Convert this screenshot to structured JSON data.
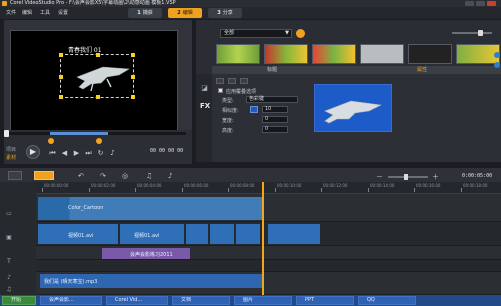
{
  "window": {
    "title": "Corel VideoStudio Pro - F:\\会声会影X5\\字幕动画\\2\\动感动画 模板1.VSP"
  },
  "menu": [
    "文件",
    "编辑",
    "工具",
    "设置"
  ],
  "steps": [
    {
      "num": "1",
      "label": "捕获"
    },
    {
      "num": "2",
      "label": "编辑"
    },
    {
      "num": "3",
      "label": "分享"
    }
  ],
  "preview": {
    "title_text": "青春我们 01",
    "mode_project": "项目",
    "mode_clip": "素材",
    "timecode": "00:00:00:00",
    "timecode_right": "00 00 00 00"
  },
  "library": {
    "category": "全部",
    "tabs": [
      "标题",
      "属性"
    ]
  },
  "options": {
    "apply_border_label": "应用覆叠选项",
    "type_label": "类型:",
    "type_value": "色彩键",
    "similarity_label": "相似度:",
    "similarity_value": "10",
    "width_label": "宽度:",
    "width_value": "0",
    "height_label": "高度:",
    "height_value": "0"
  },
  "timeline": {
    "timecode": "0:00:05:00",
    "ruler_ticks": [
      "00:00:00:00",
      "00:00:02:00",
      "00:00:04:00",
      "00:00:06:00",
      "00:00:08:00",
      "00:00:10:00",
      "00:00:12:00",
      "00:00:14:00",
      "00:00:16:00",
      "00:00:18:00"
    ],
    "clips": {
      "overlay1": "Color_Cartoon",
      "video_a": "视频01.avi",
      "video_b": "视频01.avi",
      "title1": "会声会影练习2011",
      "audio": "我们是 (晴天寒宝).mp3"
    }
  },
  "taskbar": {
    "items": [
      "开始",
      "会声会影...",
      "Corel Vid...",
      "文档",
      "图片",
      "PPT",
      "QQ"
    ]
  },
  "colors": {
    "accent": "#f3a51d",
    "clip_video": "#2e6fb8",
    "clip_title": "#7a5aa8",
    "clip_audio": "#2f66b0"
  }
}
